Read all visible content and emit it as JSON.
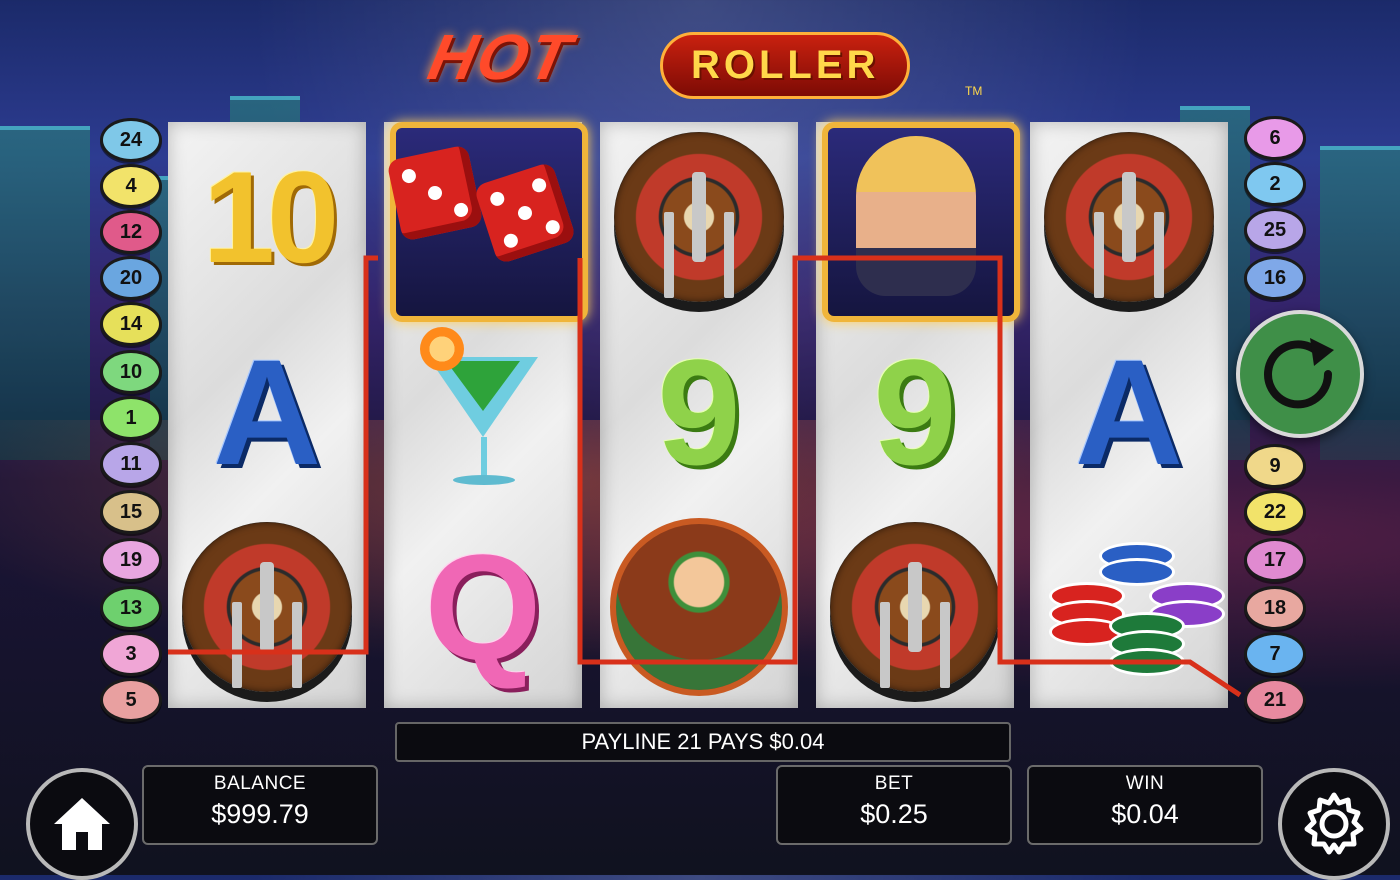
{
  "logo": {
    "word1": "HOT",
    "word2": "ROLLER",
    "tm": "TM"
  },
  "colors": {
    "payline": "#d8301a",
    "spin_button": "#3f8f48",
    "panel_bg": "#0b0b10"
  },
  "reels": [
    [
      "10",
      "A",
      "roulette-wheel"
    ],
    [
      "dice-wild",
      "martini",
      "Q"
    ],
    [
      "roulette-wheel",
      "9",
      "dealer"
    ],
    [
      "showgirl-wild",
      "9",
      "roulette-wheel"
    ],
    [
      "roulette-wheel",
      "A",
      "casino-chips"
    ]
  ],
  "paylines_left": [
    "24",
    "4",
    "12",
    "20",
    "14",
    "10",
    "1",
    "11",
    "15",
    "19",
    "13",
    "3",
    "5"
  ],
  "paylines_right": [
    "6",
    "2",
    "25",
    "16",
    "9",
    "22",
    "17",
    "18",
    "7",
    "21"
  ],
  "message": "PAYLINE 21 PAYS $0.04",
  "balance": {
    "label": "BALANCE",
    "value": "$999.79"
  },
  "bet": {
    "label": "BET",
    "value": "$0.25"
  },
  "win": {
    "label": "WIN",
    "value": "$0.04"
  },
  "icons": {
    "home": "home-icon",
    "settings": "gear-icon",
    "spin": "spin-icon"
  }
}
